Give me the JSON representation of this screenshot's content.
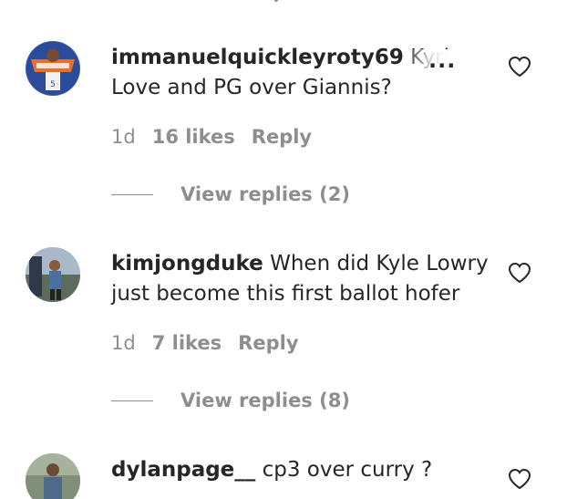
{
  "comments": [
    {
      "username": "immanuelquickleyroty69",
      "text_first": "Kyrie",
      "text_rest": "Love and PG over Giannis?",
      "more_label": "...",
      "time": "1d",
      "likes": "16 likes",
      "reply_label": "Reply",
      "view_replies": "View replies (2)"
    },
    {
      "username": "kimjongduke",
      "text": "When did Kyle Lowry just become this first ballot hofer",
      "time": "1d",
      "likes": "7 likes",
      "reply_label": "Reply",
      "view_replies": "View replies (8)"
    },
    {
      "username": "dylanpage__",
      "text": "cp3 over curry ?"
    }
  ],
  "colors": {
    "text": "#262626",
    "secondary": "#8e8e8e",
    "background": "#ffffff"
  },
  "icons": {
    "like": "heart-icon",
    "more": "more-dots-icon"
  }
}
